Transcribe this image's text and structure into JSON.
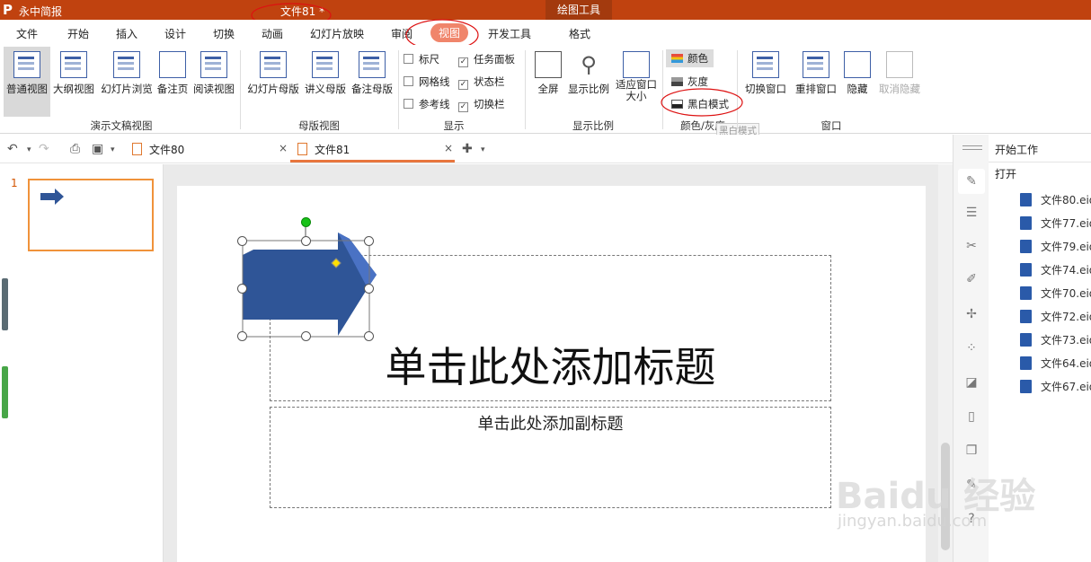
{
  "title_bar": {
    "logo": "P",
    "app_name": "永中简报",
    "document_title": "文件81 *",
    "context_tools": "绘图工具"
  },
  "menu": [
    "文件",
    "开始",
    "插入",
    "设计",
    "切换",
    "动画",
    "幻灯片放映",
    "审阅",
    "视图",
    "开发工具",
    "格式"
  ],
  "ribbon": {
    "presentation_views": {
      "group_label": "演示文稿视图",
      "buttons": [
        "普通视图",
        "大纲视图",
        "幻灯片浏览",
        "备注页",
        "阅读视图"
      ]
    },
    "master_views": {
      "group_label": "母版视图",
      "buttons": [
        "幻灯片母版",
        "讲义母版",
        "备注母版"
      ]
    },
    "show": {
      "group_label": "显示",
      "checkboxes": [
        {
          "label": "标尺",
          "checked": false
        },
        {
          "label": "网格线",
          "checked": false
        },
        {
          "label": "参考线",
          "checked": false
        },
        {
          "label": "任务面板",
          "checked": true
        },
        {
          "label": "状态栏",
          "checked": true
        },
        {
          "label": "切换栏",
          "checked": true
        }
      ]
    },
    "zoom": {
      "group_label": "显示比例",
      "buttons": [
        "全屏",
        "显示比例",
        "适应窗口大小"
      ]
    },
    "color": {
      "group_label": "颜色/灰度",
      "items": [
        "颜色",
        "灰度",
        "黑白模式"
      ],
      "tooltip": "黑白模式"
    },
    "window": {
      "group_label": "窗口",
      "buttons": [
        "切换窗口",
        "重排窗口",
        "隐藏",
        "取消隐藏"
      ]
    }
  },
  "doc_tabs": [
    {
      "label": "文件80",
      "close": "×"
    },
    {
      "label": "文件81",
      "close": "×"
    }
  ],
  "slides": {
    "number": "1"
  },
  "slide": {
    "title_placeholder": "单击此处添加标题",
    "subtitle_placeholder": "单击此处添加副标题"
  },
  "task_panel": {
    "header": "开始工作",
    "open_label": "打开",
    "files": [
      "文件80.eio",
      "文件77.eio",
      "文件79.eio",
      "文件74.eio",
      "文件70.eio",
      "文件72.eio",
      "文件73.eio",
      "文件64.eio",
      "文件67.eio"
    ]
  },
  "watermark": {
    "brand": "Baidu 经验",
    "url": "jingyan.baidu.com"
  },
  "colors": {
    "title_bar": "#c0420f",
    "active_tab": "#f0856b",
    "arrow": "#2f5597",
    "accent_tab": "#e8763d"
  }
}
